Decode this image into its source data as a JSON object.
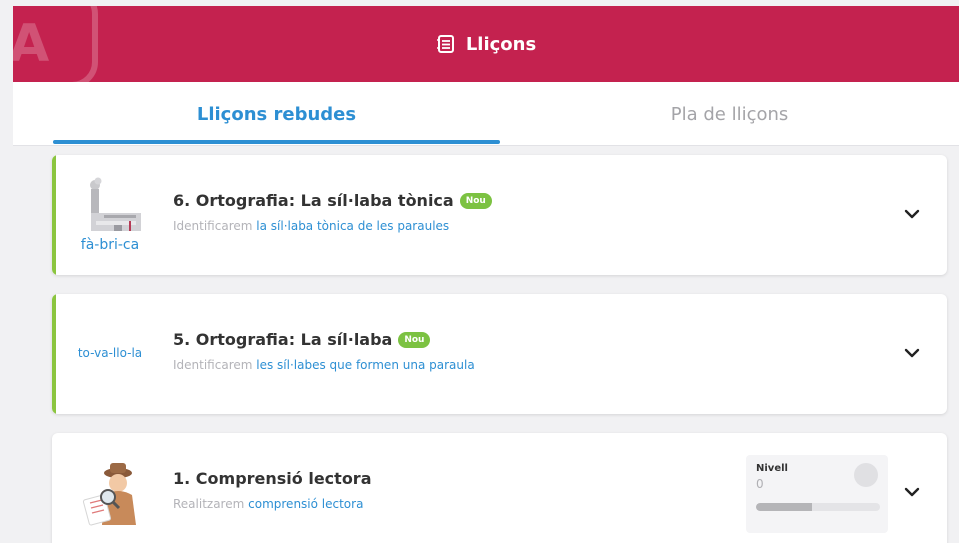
{
  "header": {
    "title": "Lliçons",
    "logo_letter": "A"
  },
  "tabs": [
    {
      "label": "Lliçons rebudes",
      "active": true
    },
    {
      "label": "Pla de lliçons",
      "active": false
    }
  ],
  "lessons": [
    {
      "title": "6. Ortografia: La síl·laba tònica",
      "badge": "Nou",
      "lead": "Identificarem",
      "topic": "la síl·laba tònica de les paraules",
      "thumb_word": "fà-bri-ca",
      "thumb_icon": "factory-icon"
    },
    {
      "title": "5. Ortografia: La síl·laba",
      "badge": "Nou",
      "lead": "Identificarem",
      "topic": "les síl·labes que formen una paraula",
      "thumb_word": "to-va-llo-la"
    },
    {
      "title": "1. Comprensió lectora",
      "lead": "Realitzarem",
      "topic": "comprensió lectora",
      "thumb_icon": "detective-icon",
      "level": {
        "label": "Nivell",
        "value": "0",
        "progress_fraction": 0.45
      }
    }
  ],
  "colors": {
    "header": "#c4224f",
    "accent_blue": "#2d8fd3",
    "accent_green": "#8bc53f",
    "badge_green": "#7cc242"
  }
}
